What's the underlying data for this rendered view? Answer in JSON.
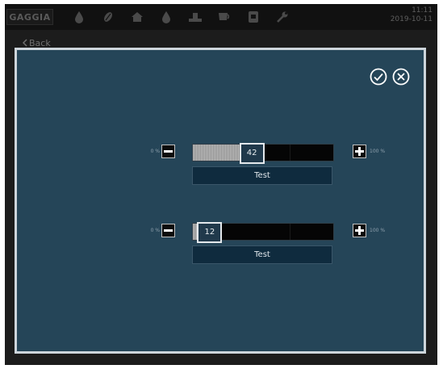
{
  "topbar": {
    "brand": "GAGGIA",
    "icons": [
      "drop-icon",
      "bean-icon",
      "house-icon",
      "drop-icon",
      "scale-icon",
      "cup-icon",
      "machine-icon",
      "wrench-icon"
    ],
    "clock": {
      "time": "11:11",
      "date": "2019-10-11"
    }
  },
  "nav": {
    "back_label": "Back"
  },
  "dialog": {
    "actions": [
      "check-icon",
      "close-icon"
    ],
    "sliders": [
      {
        "min_label": "0 %",
        "max_label": "100 %",
        "value": 42,
        "value_text": "42",
        "test_label": "Test"
      },
      {
        "min_label": "0 %",
        "max_label": "100 %",
        "value": 12,
        "value_text": "12",
        "test_label": "Test"
      }
    ]
  },
  "colors": {
    "panel": "#254558",
    "panel_border": "#cdd5db",
    "bar_track": "#050505",
    "button": "#0f2b3e"
  }
}
